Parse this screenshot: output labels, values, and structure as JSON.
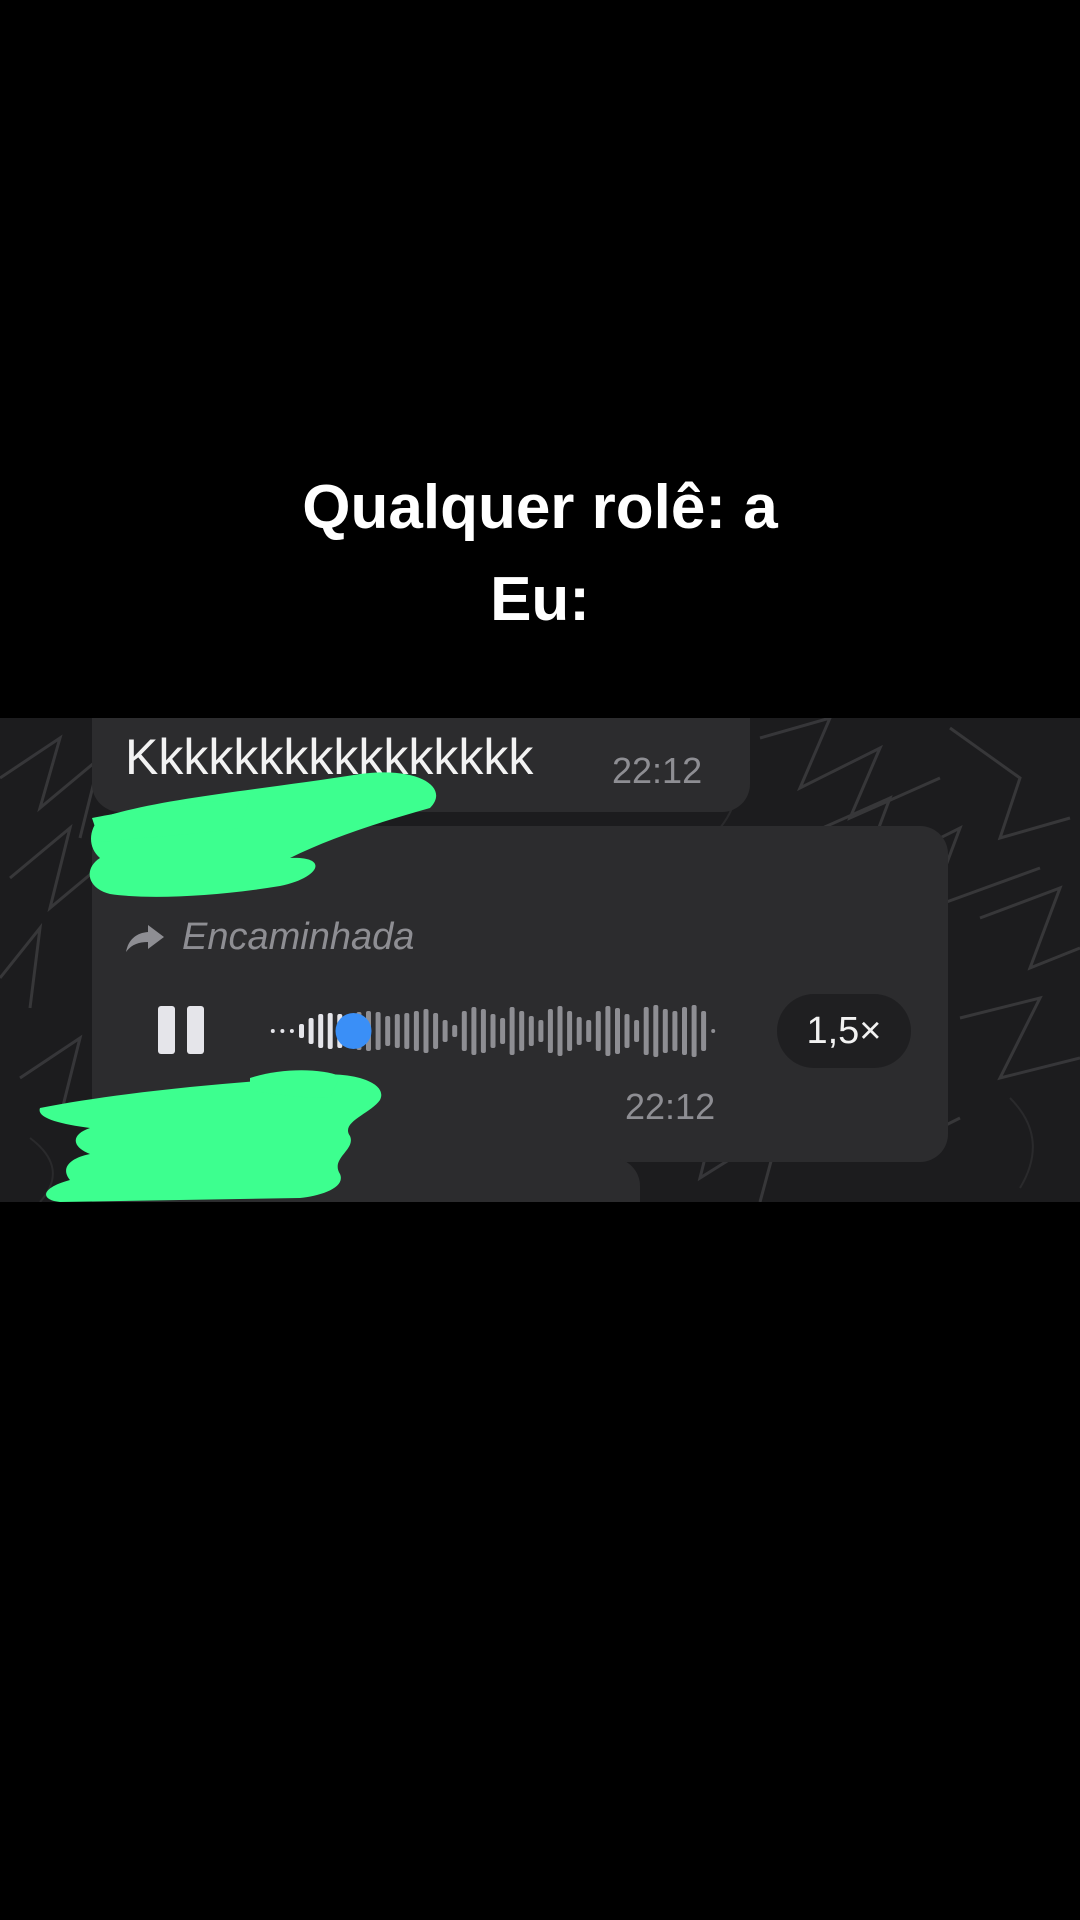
{
  "caption": {
    "line1": "Qualquer rolê: a",
    "line2": "Eu:"
  },
  "chat": {
    "message1": {
      "text": "Kkkkkkkkkkkkkkkk",
      "time": "22:12"
    },
    "voice_message": {
      "forwarded_label": "Encaminhada",
      "time": "22:12",
      "playback_speed": "1,5×",
      "playback_progress": 0.19,
      "state": "playing"
    }
  },
  "colors": {
    "background": "#000000",
    "bubble": "#2c2c2e",
    "progress_dot": "#3a8ff7",
    "scribble": "#3dff8f"
  },
  "icons": {
    "forward": "forward-arrow-icon",
    "pause": "pause-icon"
  }
}
